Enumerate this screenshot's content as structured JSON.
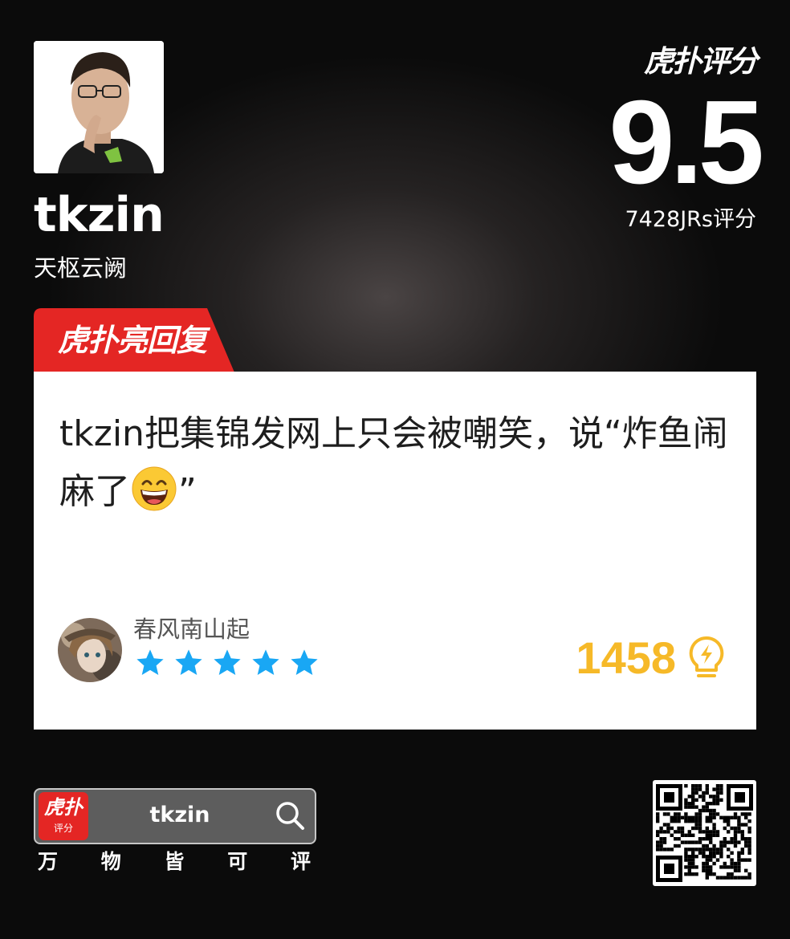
{
  "player": {
    "name": "tkzin",
    "team": "天枢云阙"
  },
  "rating": {
    "brand": "虎扑评分",
    "score": "9.5",
    "count_label": "7428JRs评分"
  },
  "hot_reply": {
    "banner": "虎扑亮回复",
    "text_before_emoji": "tkzin把集锦发网上只会被嘲笑，说“炸鱼闹麻了",
    "text_after_emoji": "”",
    "emoji": "grinning-face-emoji",
    "user": {
      "name": "春风南山起",
      "stars": 5
    },
    "likes": "1458"
  },
  "footer": {
    "app_icon_main": "虎扑",
    "app_icon_sub": "评分",
    "search_text": "tkzin",
    "slogan": [
      "万",
      "物",
      "皆",
      "可",
      "评"
    ]
  },
  "colors": {
    "banner_red": "#e42624",
    "star_blue": "#19a7f4",
    "likes_gold": "#f6b928"
  }
}
